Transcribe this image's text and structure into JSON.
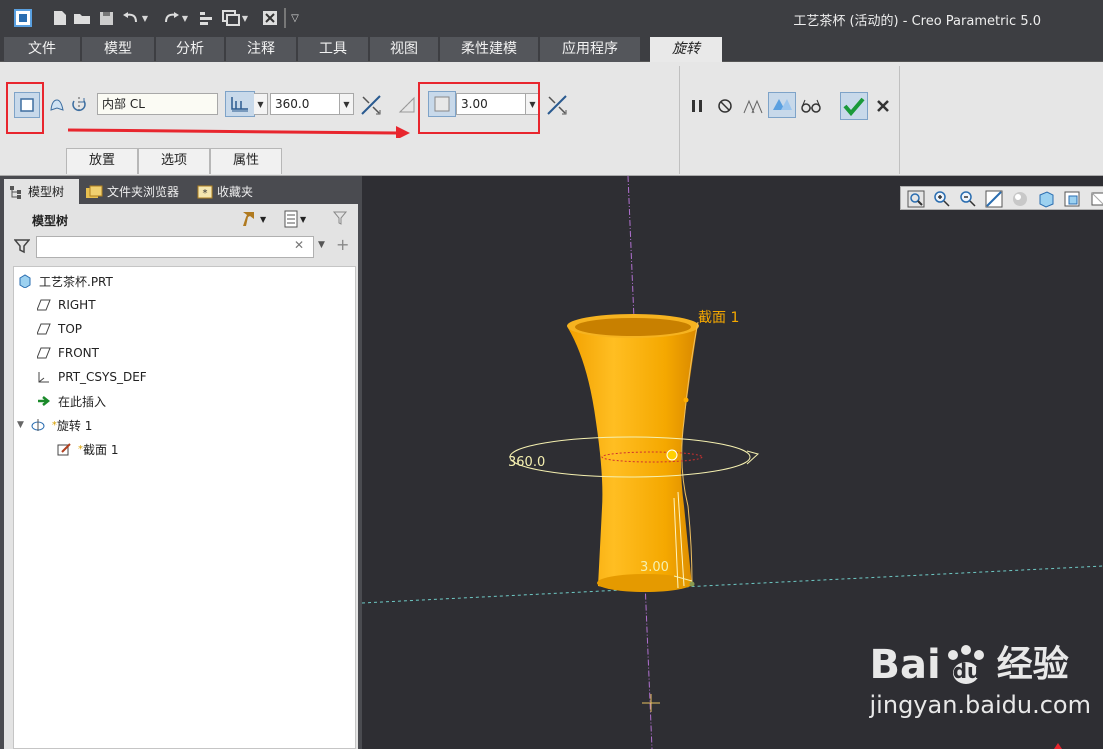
{
  "window": {
    "title": "工艺茶杯 (活动的) - Creo Parametric 5.0"
  },
  "quick_access": {
    "undo_icon": "undo-icon",
    "redo_icon": "redo-icon"
  },
  "menu": {
    "tabs": [
      "文件",
      "模型",
      "分析",
      "注释",
      "工具",
      "视图",
      "柔性建模",
      "应用程序"
    ],
    "active_tab": "旋转"
  },
  "ribbon": {
    "axis_label": "内部 CL",
    "angle_value": "360.0",
    "thickness_value": "3.00",
    "subtabs": [
      "放置",
      "选项",
      "属性"
    ],
    "highlight_color": "#e8262e"
  },
  "panel": {
    "tabs": [
      "模型树",
      "文件夹浏览器",
      "收藏夹"
    ],
    "header": "模型树",
    "filter_placeholder": ""
  },
  "tree": {
    "root": "工艺茶杯.PRT",
    "items": [
      "RIGHT",
      "TOP",
      "FRONT",
      "PRT_CSYS_DEF",
      "在此插入"
    ],
    "feature": "旋转 1",
    "sketch": "截面 1"
  },
  "viewport": {
    "section_label": "截面 1",
    "angle_dim": "360.0",
    "thickness_dim": "3.00",
    "model_color": "#f5a800"
  },
  "watermark": {
    "text1": "Bai",
    "text2": "du",
    "text3": "经验",
    "url": "jingyan.baidu.com"
  }
}
